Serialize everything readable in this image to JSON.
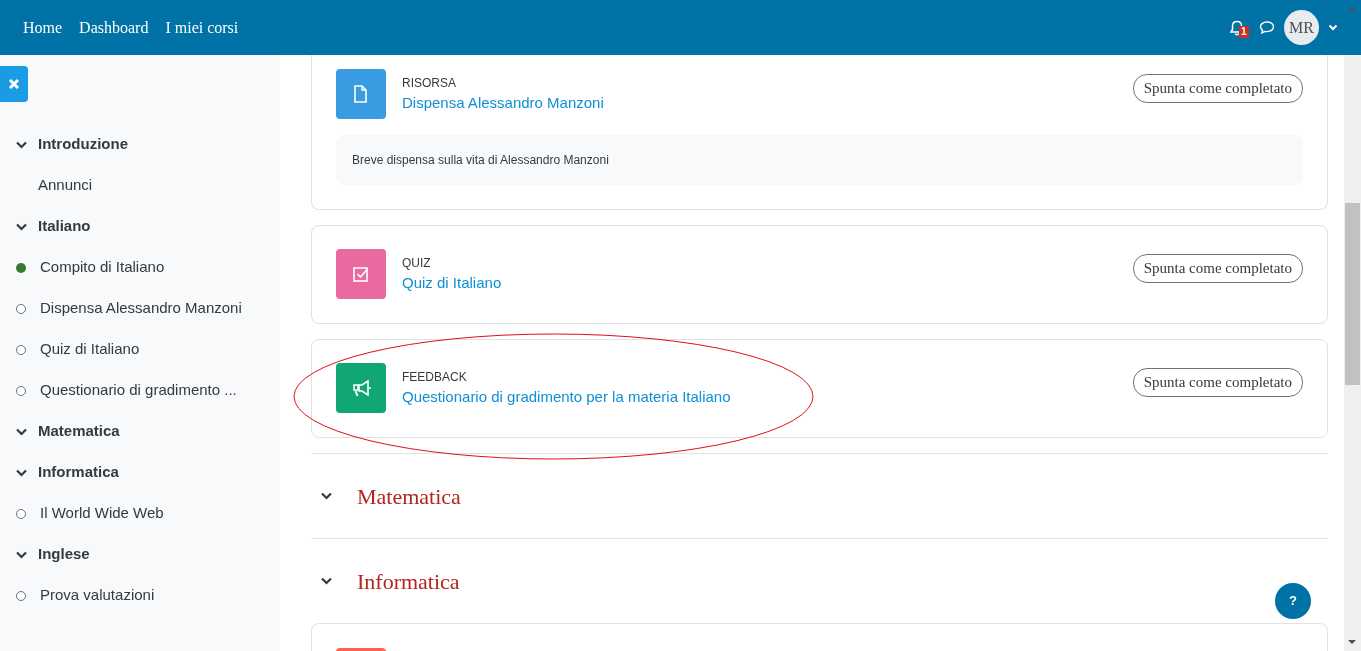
{
  "navbar": {
    "links": [
      "Home",
      "Dashboard",
      "I miei corsi"
    ],
    "notification_count": "1",
    "avatar_initials": "MR"
  },
  "sidebar": {
    "sections": [
      {
        "title": "Introduzione",
        "expanded": true,
        "children": [
          {
            "kind": "plain",
            "label": "Annunci"
          }
        ]
      },
      {
        "title": "Italiano",
        "expanded": true,
        "children": [
          {
            "kind": "tracked",
            "label": "Compito di Italiano",
            "completed": true
          },
          {
            "kind": "tracked",
            "label": "Dispensa Alessandro Manzoni",
            "completed": false
          },
          {
            "kind": "tracked",
            "label": "Quiz di Italiano",
            "completed": false
          },
          {
            "kind": "tracked",
            "label": "Questionario di gradimento ...",
            "completed": false
          }
        ]
      },
      {
        "title": "Matematica",
        "expanded": true
      },
      {
        "title": "Informatica",
        "expanded": true,
        "children": [
          {
            "kind": "tracked",
            "label": "Il World Wide Web",
            "completed": false
          }
        ]
      },
      {
        "title": "Inglese",
        "expanded": true,
        "children": [
          {
            "kind": "tracked",
            "label": "Prova valutazioni",
            "completed": false
          }
        ]
      }
    ]
  },
  "activities": [
    {
      "kind": "resource",
      "color": "#399be2",
      "type": "RISORSA",
      "name": "Dispensa Alessandro Manzoni",
      "description": "Breve dispensa sulla vita di Alessandro Manzoni",
      "completion_button": "Spunta come completato"
    },
    {
      "kind": "quiz",
      "color": "#e86aa0",
      "type": "QUIZ",
      "name": "Quiz di Italiano",
      "completion_button": "Spunta come completato"
    },
    {
      "kind": "feedback",
      "color": "#11a676",
      "type": "FEEDBACK",
      "name": "Questionario di gradimento per la materia Italiano",
      "completion_button": "Spunta come completato",
      "circled": true
    }
  ],
  "sections": [
    {
      "title": "Matematica",
      "expanded": true
    },
    {
      "title": "Informatica",
      "expanded": true,
      "activities": [
        {
          "kind": "partial",
          "color": "#f7634d"
        }
      ]
    }
  ],
  "help_button": "?"
}
